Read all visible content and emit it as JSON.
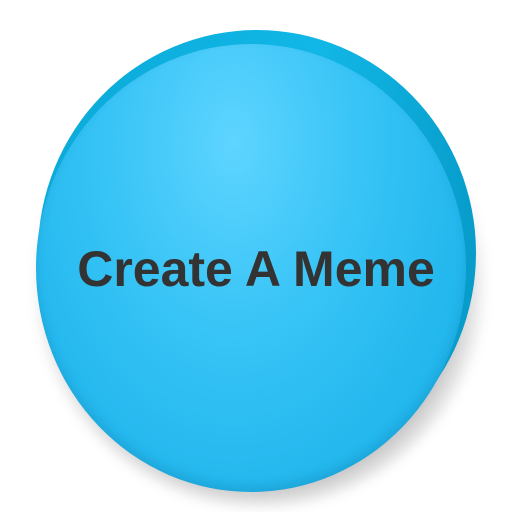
{
  "app_icon": {
    "label": "Create A Meme",
    "colors": {
      "disc": "#33c0f3",
      "disc_edge": "#0aa9d8",
      "text": "#333333",
      "background": "#ffffff"
    }
  }
}
